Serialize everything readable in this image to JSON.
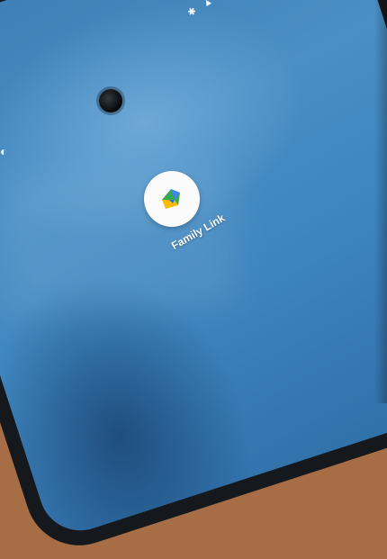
{
  "app": {
    "label": "Family Link",
    "icon_name": "family-link-icon"
  },
  "status_bar": {
    "icons": [
      "bluetooth-icon",
      "wifi-icon",
      "signal-icon",
      "battery-icon"
    ],
    "battery_text": "%"
  },
  "colors": {
    "wallpaper": "#3f86bf",
    "icon_background": "#fbfbfb",
    "brand_green": "#34a853",
    "brand_blue": "#4285f4",
    "brand_yellow": "#fbbc05"
  }
}
